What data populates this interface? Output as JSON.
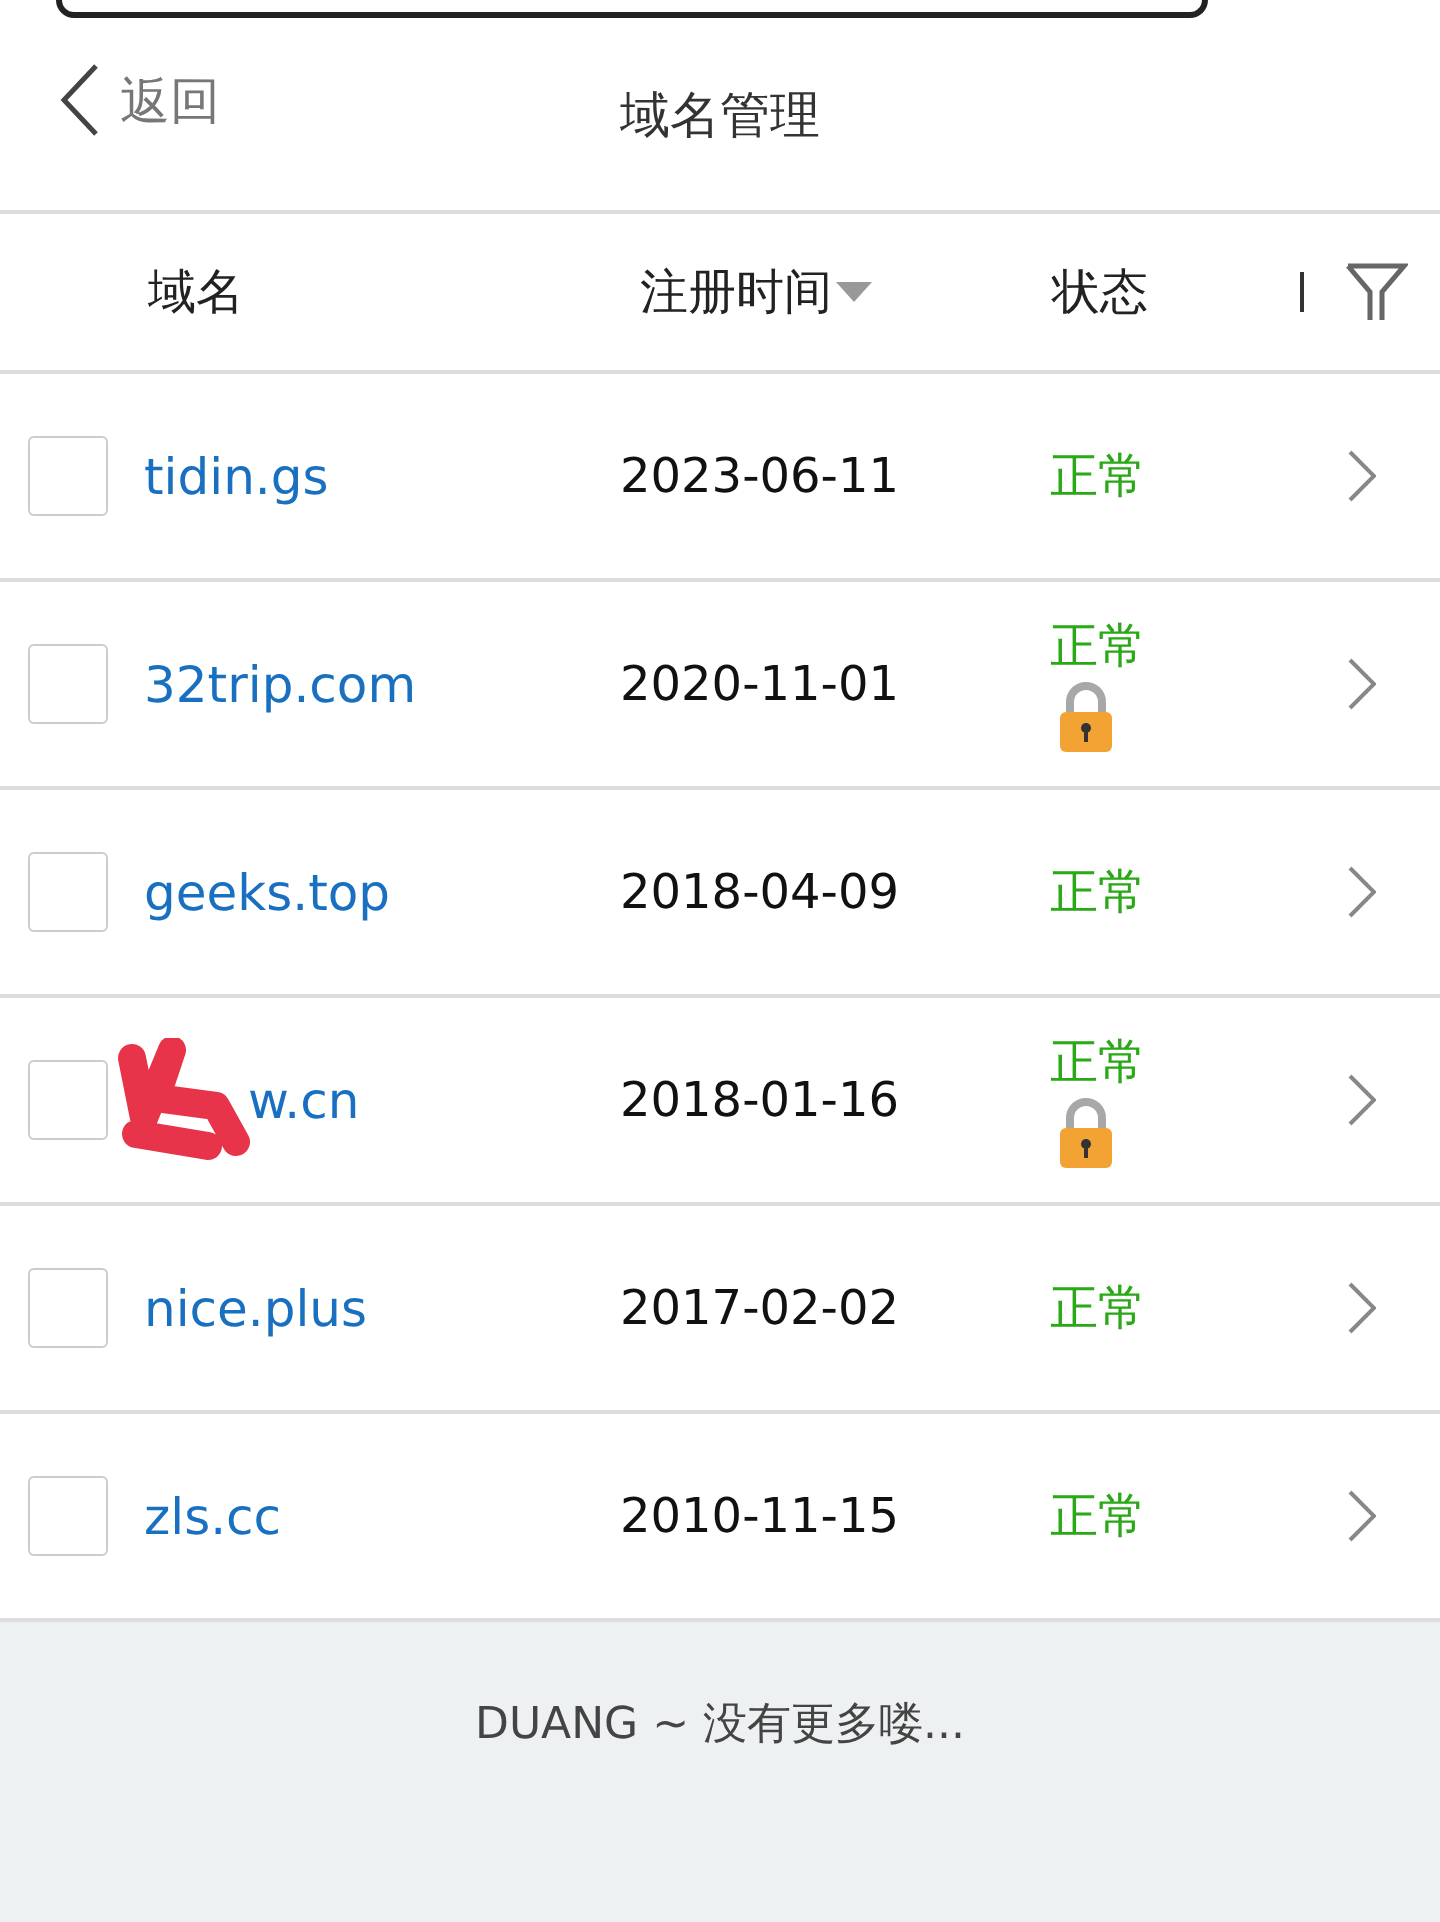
{
  "nav": {
    "back_label": "返回",
    "title": "域名管理"
  },
  "columns": [
    {
      "label": "域名",
      "sorted": false
    },
    {
      "label": "注册时间",
      "sorted": true
    },
    {
      "label": "状态",
      "sorted": false
    }
  ],
  "rows": [
    {
      "domain": "tidin.gs",
      "date": "2023-06-11",
      "status": "正常",
      "locked": false,
      "checked": false,
      "redacted": false
    },
    {
      "domain": "32trip.com",
      "date": "2020-11-01",
      "status": "正常",
      "locked": true,
      "checked": false,
      "redacted": false
    },
    {
      "domain": "geeks.top",
      "date": "2018-04-09",
      "status": "正常",
      "locked": false,
      "checked": false,
      "redacted": false
    },
    {
      "domain": "w.cn",
      "date": "2018-01-16",
      "status": "正常",
      "locked": true,
      "checked": false,
      "redacted": true
    },
    {
      "domain": "nice.plus",
      "date": "2017-02-02",
      "status": "正常",
      "locked": false,
      "checked": false,
      "redacted": false
    },
    {
      "domain": "zls.cc",
      "date": "2010-11-15",
      "status": "正常",
      "locked": false,
      "checked": false,
      "redacted": false
    }
  ],
  "footer": "DUANG ~ 没有更多喽..."
}
